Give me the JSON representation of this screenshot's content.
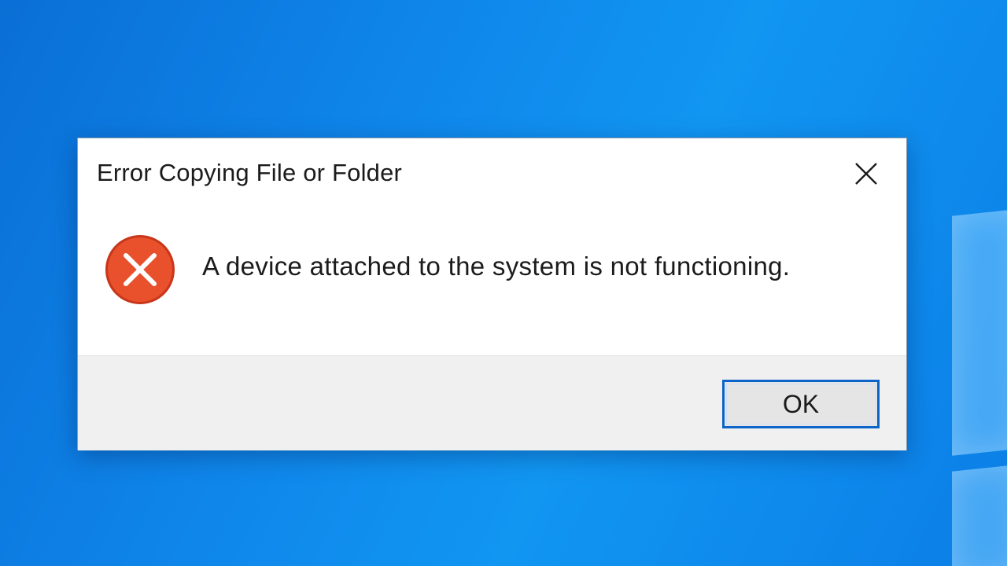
{
  "dialog": {
    "title": "Error Copying File or Folder",
    "message": "A device attached to the system is not functioning.",
    "ok_label": "OK",
    "icon": "error-icon",
    "close_icon": "close-icon"
  },
  "colors": {
    "desktop_blue": "#0f86ea",
    "error_red": "#e9502c",
    "button_focus_border": "#0c63c9",
    "footer_gray": "#f0f0f0"
  }
}
